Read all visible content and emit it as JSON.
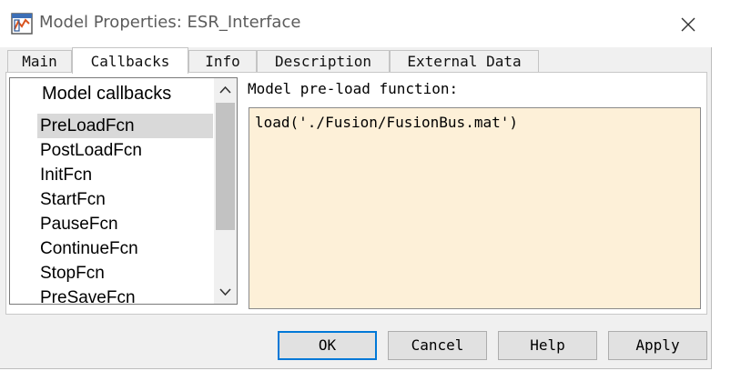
{
  "window": {
    "title": "Model Properties: ESR_Interface",
    "icon": "simulink-model-icon",
    "close_icon": "close-icon"
  },
  "tabs": [
    {
      "label": "Main",
      "active": false
    },
    {
      "label": "Callbacks",
      "active": true
    },
    {
      "label": "Info",
      "active": false
    },
    {
      "label": "Description",
      "active": false
    },
    {
      "label": "External Data",
      "active": false
    }
  ],
  "callbacks": {
    "header": "Model callbacks",
    "items": [
      "PreLoadFcn",
      "PostLoadFcn",
      "InitFcn",
      "StartFcn",
      "PauseFcn",
      "ContinueFcn",
      "StopFcn",
      "PreSaveFcn"
    ],
    "selected": "PreLoadFcn",
    "scroll_up_icon": "chevron-up-icon",
    "scroll_down_icon": "chevron-down-icon"
  },
  "editor": {
    "label": "Model pre-load function:",
    "value": "load('./Fusion/FusionBus.mat')"
  },
  "buttons": {
    "ok": "OK",
    "cancel": "Cancel",
    "help": "Help",
    "apply": "Apply"
  },
  "colors": {
    "editor_background": "#fdf0d8",
    "selection": "#d9d9d9",
    "default_button_border": "#0078d7"
  }
}
